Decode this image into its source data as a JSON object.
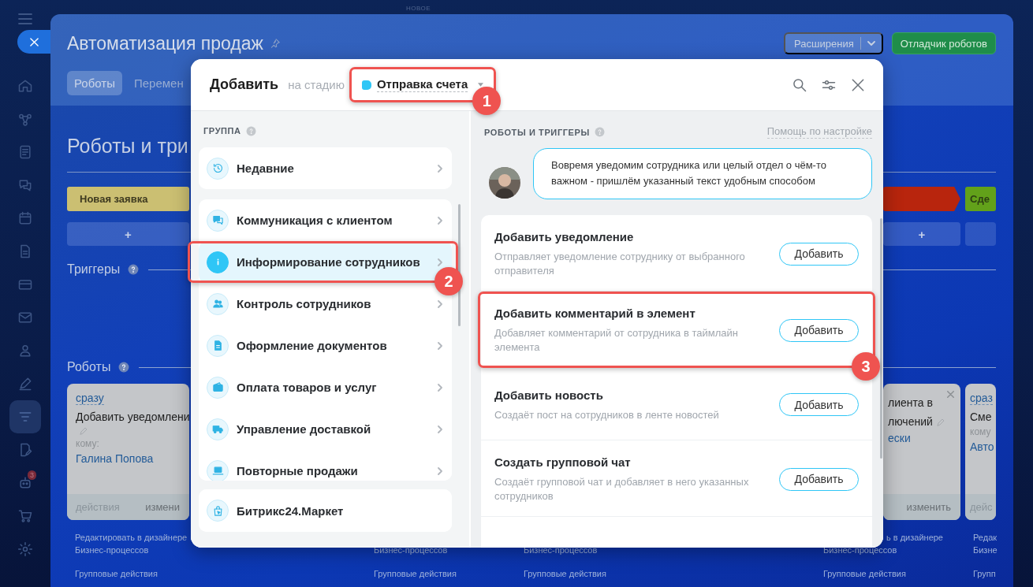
{
  "top_label": "НОВОЕ",
  "sidebar": {
    "badge": "3",
    "items": [
      {
        "selected": false
      },
      {
        "selected": false
      },
      {
        "selected": false
      },
      {
        "selected": false
      },
      {
        "selected": false
      },
      {
        "selected": false
      },
      {
        "selected": false
      },
      {
        "selected": false
      },
      {
        "selected": false
      },
      {
        "selected": false
      },
      {
        "selected": true
      },
      {
        "selected": false
      },
      {
        "selected": false
      },
      {
        "selected": false
      },
      {
        "selected": false
      }
    ]
  },
  "page": {
    "title": "Автоматизация продаж",
    "extensions_button": "Расширения",
    "debugger_button": "Отладчик роботов",
    "tabs": [
      {
        "label": "Роботы",
        "selected": true
      },
      {
        "label": "Перемен",
        "selected": false
      }
    ],
    "heading": "Роботы и три",
    "stages": [
      {
        "label": "Новая заявка",
        "color": "#cbbf72"
      },
      {
        "color": "#b8250d"
      },
      {
        "label": "Сде",
        "color": "#62a11a"
      }
    ],
    "add_buttons": [
      "+",
      "+"
    ],
    "triggers_label": "Триггеры",
    "robots_label": "Роботы",
    "robot_cards": [
      {
        "delay": "сразу",
        "title": "Добавить уведомлени",
        "editable": true,
        "to_label": "кому:",
        "to": "Галина Попова",
        "actions": "действия",
        "edit": "измени"
      },
      {
        "lines": [
          "лиента в",
          "лючений"
        ],
        "editable": true,
        "closable": true,
        "to": "ески",
        "edit": "изменить"
      },
      {
        "delay": "сраз",
        "title": "Сме",
        "to_label": "кому",
        "to": "Авто",
        "actions": "дейс"
      }
    ],
    "footer_columns": [
      {
        "lines": [
          "Редактировать в дизайнере",
          "Бизнес-процессов"
        ],
        "action": "Групповые действия"
      },
      {
        "lines": [
          "Бизнес-процессов"
        ],
        "action": "Групповые действия"
      },
      {
        "lines": [
          "Бизнес-процессов"
        ],
        "action": "Групповые действия"
      },
      {
        "lines": [
          "ь в дизайнере",
          "Бизнес-процессов"
        ],
        "action": "Групповые действия"
      },
      {
        "lines": [
          "Редак",
          "Бизне"
        ],
        "action": "Групп"
      }
    ]
  },
  "modal": {
    "title": "Добавить",
    "stage_prefix": "на стадию",
    "stage": {
      "label": "Отправка счета",
      "color": "#2fc6f6",
      "callout": "1"
    },
    "groups_label": "ГРУППА",
    "recent": {
      "label": "Недавние",
      "selected": false
    },
    "groups": [
      {
        "label": "Коммуникация с клиентом",
        "selected": false
      },
      {
        "label": "Информирование сотрудников",
        "selected": true,
        "callout": "2"
      },
      {
        "label": "Контроль сотрудников",
        "selected": false
      },
      {
        "label": "Оформление документов",
        "selected": false
      },
      {
        "label": "Оплата товаров и услуг",
        "selected": false
      },
      {
        "label": "Управление доставкой",
        "selected": false
      },
      {
        "label": "Повторные продажи",
        "selected": false
      }
    ],
    "market": {
      "label": "Битрикс24.Маркет",
      "selected": false
    },
    "robots_label": "РОБОТЫ И ТРИГГЕРЫ",
    "help_link": "Помощь по настройке",
    "hint": "Вовремя уведомим сотрудника или целый отдел о чём-то важном - пришлём указанный текст удобным способом",
    "robots": [
      {
        "title": "Добавить уведомление",
        "description": "Отправляет уведомление сотруднику от выбранного отправителя",
        "button": "Добавить"
      },
      {
        "title": "Добавить комментарий в элемент",
        "description": "Добавляет комментарий от сотрудника в таймлайн элемента",
        "button": "Добавить",
        "callout": "3"
      },
      {
        "title": "Добавить новость",
        "description": "Создаёт пост на сотрудников в ленте новостей",
        "button": "Добавить"
      },
      {
        "title": "Создать групповой чат",
        "description": "Создаёт групповой чат и добавляет в него указанных сотрудников",
        "button": "Добавить"
      }
    ]
  }
}
